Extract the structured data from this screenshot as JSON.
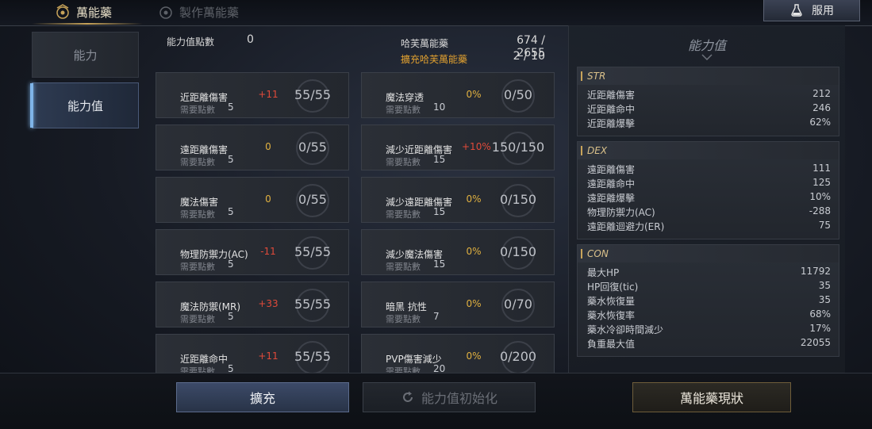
{
  "tabs": {
    "active": "萬能藥",
    "inactive": "製作萬能藥"
  },
  "use_button": {
    "label": "服用"
  },
  "sidenav": {
    "items": [
      {
        "label": "能力"
      },
      {
        "label": "能力值"
      }
    ]
  },
  "points": {
    "label": "能力值點數",
    "value": "0"
  },
  "potion": {
    "label": "哈芙萬能藥",
    "value": "674 / 2655",
    "expand_label": "擴充哈芙萬能藥",
    "expand_value": "2 / 10"
  },
  "cost_label": "需要點數",
  "stats_left": [
    {
      "name": "近距離傷害",
      "bonus": "+11",
      "bonus_color": "red",
      "level": "55/55",
      "cost": "5"
    },
    {
      "name": "遠距離傷害",
      "bonus": "0",
      "bonus_color": "gold",
      "level": "0/55",
      "cost": "5"
    },
    {
      "name": "魔法傷害",
      "bonus": "0",
      "bonus_color": "gold",
      "level": "0/55",
      "cost": "5"
    },
    {
      "name": "物理防禦力(AC)",
      "bonus": "-11",
      "bonus_color": "red",
      "level": "55/55",
      "cost": "5"
    },
    {
      "name": "魔法防禦(MR)",
      "bonus": "+33",
      "bonus_color": "red",
      "level": "55/55",
      "cost": "5"
    },
    {
      "name": "近距離命中",
      "bonus": "+11",
      "bonus_color": "red",
      "level": "55/55",
      "cost": "5"
    }
  ],
  "stats_right": [
    {
      "name": "魔法穿透",
      "bonus": "0%",
      "bonus_color": "gold",
      "level": "0/50",
      "cost": "10"
    },
    {
      "name": "減少近距離傷害",
      "bonus": "+10%",
      "bonus_color": "red",
      "level": "150/150",
      "cost": "15"
    },
    {
      "name": "減少遠距離傷害",
      "bonus": "0%",
      "bonus_color": "gold",
      "level": "0/150",
      "cost": "15"
    },
    {
      "name": "減少魔法傷害",
      "bonus": "0%",
      "bonus_color": "gold",
      "level": "0/150",
      "cost": "15"
    },
    {
      "name": "暗黑 抗性",
      "bonus": "0%",
      "bonus_color": "gold",
      "level": "0/70",
      "cost": "7"
    },
    {
      "name": "PVP傷害減少",
      "bonus": "0%",
      "bonus_color": "gold",
      "level": "0/200",
      "cost": "20"
    }
  ],
  "summary": {
    "title": "能力值",
    "groups": [
      {
        "name": "STR",
        "rows": [
          {
            "label": "近距離傷害",
            "value": "212"
          },
          {
            "label": "近距離命中",
            "value": "246"
          },
          {
            "label": "近距離爆擊",
            "value": "62%"
          }
        ]
      },
      {
        "name": "DEX",
        "rows": [
          {
            "label": "遠距離傷害",
            "value": "111"
          },
          {
            "label": "遠距離命中",
            "value": "125"
          },
          {
            "label": "遠距離爆擊",
            "value": "10%"
          },
          {
            "label": "物理防禦力(AC)",
            "value": "-288"
          },
          {
            "label": "遠距離迴避力(ER)",
            "value": "75"
          }
        ]
      },
      {
        "name": "CON",
        "rows": [
          {
            "label": "最大HP",
            "value": "11792"
          },
          {
            "label": "HP回復(tic)",
            "value": "35"
          },
          {
            "label": "藥水恢復量",
            "value": "35"
          },
          {
            "label": "藥水恢復率",
            "value": "68%"
          },
          {
            "label": "藥水冷卻時間減少",
            "value": "17%"
          },
          {
            "label": "負重最大值",
            "value": "22055"
          }
        ]
      }
    ]
  },
  "buttons": {
    "expand": "擴充",
    "reset": "能力值初始化",
    "status": "萬能藥現狀"
  },
  "colors": {
    "accent_gold": "#c8a45a",
    "accent_blue": "#7fb4e8",
    "bonus_red": "#e04a3a",
    "bonus_gold": "#e0b040"
  }
}
